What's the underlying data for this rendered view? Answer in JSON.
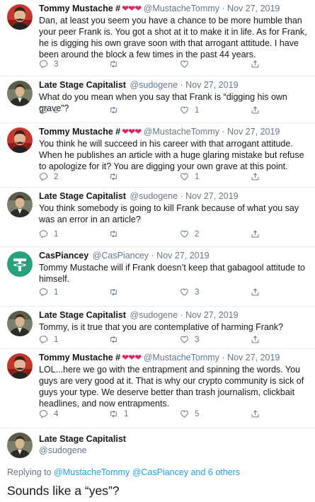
{
  "icons": {
    "reply": "reply-icon",
    "retweet": "retweet-icon",
    "like": "heart-icon",
    "share": "share-icon"
  },
  "colors": {
    "link": "#1da1f2",
    "meta": "#657786",
    "heart": "#e0245e",
    "divider": "#e6ecf0",
    "tether": "#26a17b"
  },
  "tweets": [
    {
      "name": "Tommy Mustache #",
      "hearts": "❤❤❤",
      "handle": "@MustacheTommy",
      "date": "Nov 27, 2019",
      "text": "Dan, at least you seem you have a chance to be more humble than your peer Frank is.  You got a shot at it to make it in life.  As for Frank, he is digging his own grave soon with that arrogant attitude.  I have been around the block a few times in the past 44 years.",
      "replies": "3",
      "retweets": "",
      "likes": ""
    },
    {
      "name": "Late Stage Capitalist",
      "hearts": "",
      "handle": "@sudogene",
      "date": "Nov 27, 2019",
      "text": "What do you mean when you say that Frank is “digging his own grave”?",
      "replies": "2",
      "retweets": "",
      "likes": "1"
    },
    {
      "name": "Tommy Mustache #",
      "hearts": "❤❤❤",
      "handle": "@MustacheTommy",
      "date": "Nov 27, 2019",
      "text": "You think he will succeed in his career with that arrogant attitude. When he publishes an article with a huge glaring mistake but refuse to apologize for it?  You are digging your own grave at this point.",
      "replies": "2",
      "retweets": "",
      "likes": "1"
    },
    {
      "name": "Late Stage Capitalist",
      "hearts": "",
      "handle": "@sudogene",
      "date": "Nov 27, 2019",
      "text": "You think somebody is going to kill Frank because of what you say was an error in an article?",
      "replies": "1",
      "retweets": "",
      "likes": "2"
    },
    {
      "name": "CasPiancey",
      "hearts": "",
      "handle": "@CasPiancey",
      "date": "Nov 27, 2019",
      "text": "Tommy Mustache will if Frank doesn’t keep that gabagool attitude to himself.",
      "replies": "1",
      "retweets": "",
      "likes": "3"
    },
    {
      "name": "Late Stage Capitalist",
      "hearts": "",
      "handle": "@sudogene",
      "date": "Nov 27, 2019",
      "text": "Tommy, is it true that you are contemplative of harming Frank?",
      "replies": "1",
      "retweets": "",
      "likes": "3"
    },
    {
      "name": "Tommy Mustache #",
      "hearts": "❤❤❤",
      "handle": "@MustacheTommy",
      "date": "Nov 27, 2019",
      "text": "LOL...here we go with the entrapment and spinning the words.  You guys are very good at it.  That is why our crypto community is sick of guys your type.  We deserve better than trash journalism, clickbait headlines, and now entrapments.",
      "replies": "4",
      "retweets": "1",
      "likes": "5"
    }
  ],
  "main": {
    "name": "Late Stage Capitalist",
    "handle": "@sudogene",
    "replying_prefix": "Replying to",
    "replying_user1": "@MustacheTommy",
    "replying_user2": "@CasPiancey",
    "replying_rest": "and 6 others",
    "text": "Sounds like a “yes”?"
  }
}
